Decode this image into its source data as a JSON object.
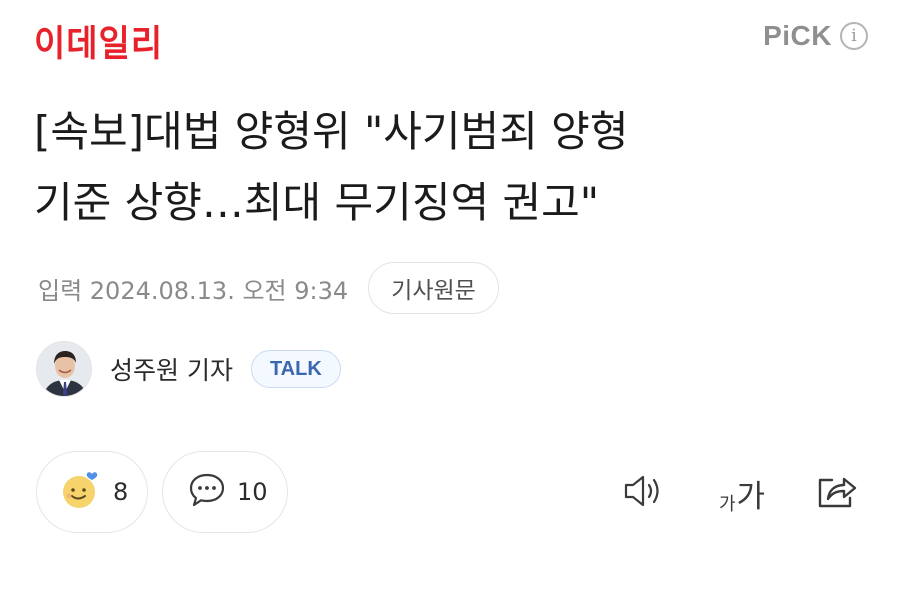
{
  "header": {
    "logo_text": "이데일리",
    "pick_label": "PiCK",
    "info_icon": "i"
  },
  "article": {
    "headline_line1": "[속보]대법 양형위 \"사기범죄 양형",
    "headline_line2": "기준 상향…최대 무기징역 권고\"",
    "meta": "입력 2024.08.13. 오전 9:34",
    "original_button": "기사원문"
  },
  "reporter": {
    "name": "성주원 기자",
    "talk_button": "TALK"
  },
  "reactions": {
    "emotion_count": "8",
    "comment_count": "10"
  },
  "toolbar": {
    "font_small": "가",
    "font_big": "가"
  },
  "colors": {
    "brand": "#e8222b",
    "talk": "#3b67b0"
  }
}
